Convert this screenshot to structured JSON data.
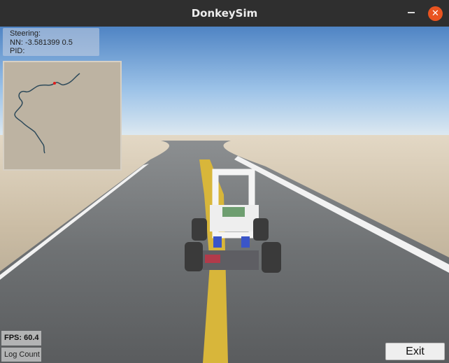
{
  "window": {
    "title": "DonkeySim",
    "close_glyph": "✕"
  },
  "hud": {
    "steering_label": "Steering:",
    "nn_line": "NN: -3.581399 0.5",
    "pid_label": "PID:"
  },
  "fps": "FPS: 60.4",
  "log_count": "Log Count",
  "exit_label": "Exit",
  "icons": {
    "minimize": "minimize-icon",
    "close": "close-icon"
  },
  "colors": {
    "close_button": "#e95420",
    "titlebar": "#2f2f2f",
    "minimap_path": "#2e4a5a",
    "minimap_marker": "#e21c1c"
  }
}
